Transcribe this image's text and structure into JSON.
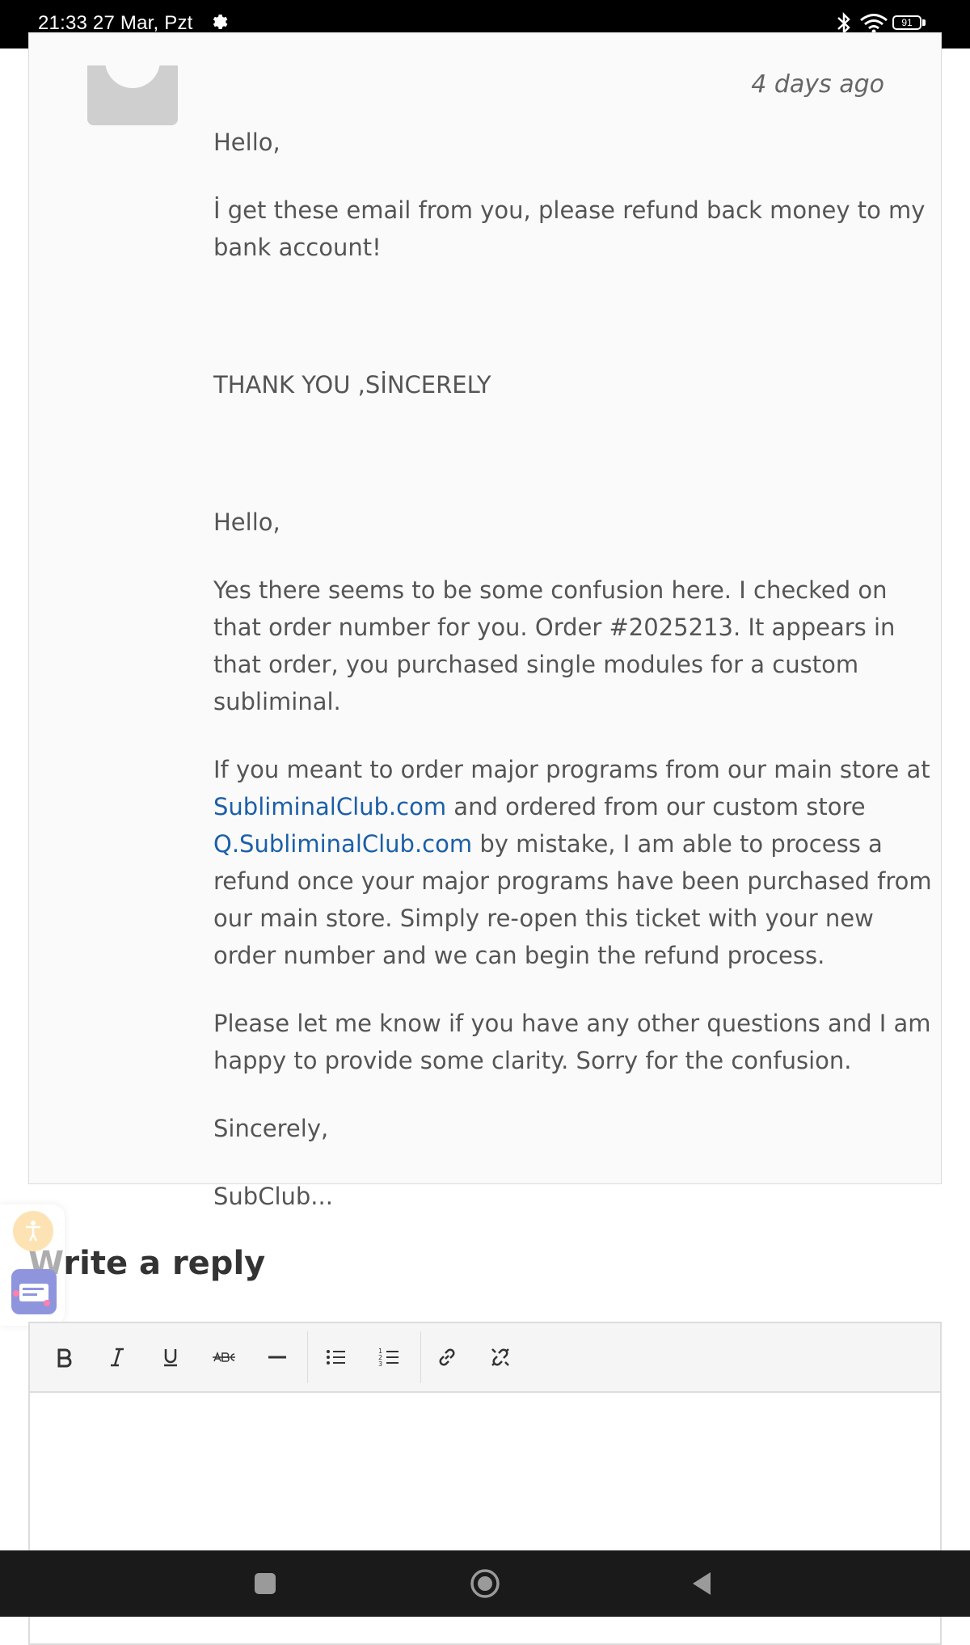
{
  "status_bar": {
    "time": "21:33  27 Mar, Pzt",
    "battery": "91"
  },
  "comment": {
    "time_ago": "4 days ago",
    "customer": {
      "greeting": "Hello,",
      "body": "İ get these email from you, please refund back money to my bank account!",
      "signoff": "THANK YOU ,SİNCERELY"
    },
    "agent": {
      "greeting": "Hello,",
      "para1": "Yes there seems to be some confusion here. I checked on that order number for you. Order #2025213. It appears in that order, you purchased single modules for a custom subliminal.",
      "para2_a": "If you meant to order major programs from our main store at ",
      "link_main": "SubliminalClub.com",
      "para2_b": " and ordered from our custom store ",
      "link_custom": "Q.SubliminalClub.com",
      "para2_c": " by mistake, I am able to process a refund once your major programs have been purchased from our main store. Simply re-open this ticket with your new order number and we can begin the refund process.",
      "para3": "Please let me know if you have any other questions and I am happy to provide some clarity. Sorry for the confusion.",
      "closing": "Sincerely,",
      "signature": "SubClub..."
    }
  },
  "reply": {
    "title": "Write a reply"
  },
  "toolbar_icons": [
    "bold-icon",
    "italic-icon",
    "underline-icon",
    "strikethrough-icon",
    "horizontal-rule-icon",
    "bullet-list-icon",
    "numbered-list-icon",
    "link-icon",
    "unlink-icon"
  ]
}
